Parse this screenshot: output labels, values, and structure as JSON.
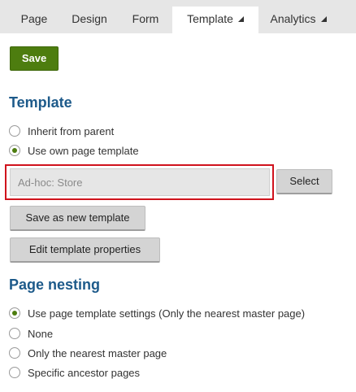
{
  "tabs": [
    {
      "label": "Page"
    },
    {
      "label": "Design"
    },
    {
      "label": "Form"
    },
    {
      "label": "Template",
      "active": true,
      "has_menu": true
    },
    {
      "label": "Analytics",
      "has_menu": true
    }
  ],
  "save_label": "Save",
  "template_section": {
    "title": "Template",
    "options": [
      {
        "label": "Inherit from parent",
        "checked": false
      },
      {
        "label": "Use own page template",
        "checked": true
      }
    ],
    "template_value": "Ad-hoc: Store",
    "select_label": "Select",
    "save_as_new_label": "Save as new template",
    "edit_props_label": "Edit template properties"
  },
  "nesting_section": {
    "title": "Page nesting",
    "options": [
      {
        "label": "Use page template settings (Only the nearest master page)",
        "checked": true
      },
      {
        "label": "None",
        "checked": false
      },
      {
        "label": "Only the nearest master page",
        "checked": false
      },
      {
        "label": "Specific ancestor pages",
        "checked": false
      }
    ]
  },
  "colors": {
    "accent_green": "#4d7d0f",
    "heading_blue": "#1d5a8a",
    "highlight_red": "#d0131d"
  }
}
